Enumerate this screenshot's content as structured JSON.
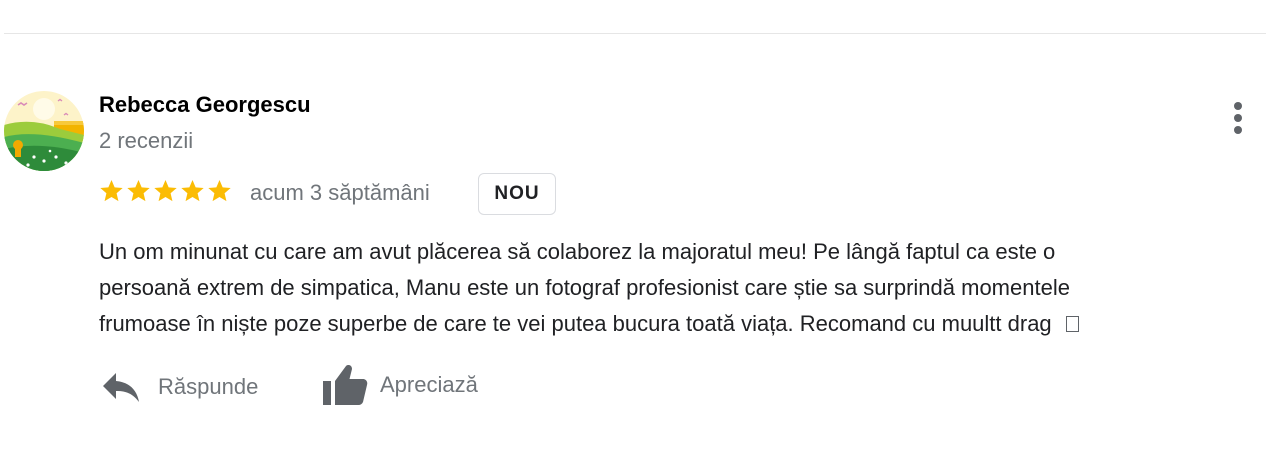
{
  "review": {
    "author": "Rebecca Georgescu",
    "review_count": "2 recenzii",
    "rating": 5,
    "rating_max": 5,
    "time": "acum 3 săptămâni",
    "badge": "NOU",
    "text_lines": [
      "Un om minunat cu care am avut plăcerea să colaborez la majoratul meu! Pe lângă faptul ca este o",
      "persoană extrem de simpatica, Manu este un fotograf profesionist care știe sa surprindă momentele",
      "frumoase în niște poze superbe de care te vei putea bucura toată viața. Recomand cu muultt drag"
    ]
  },
  "actions": {
    "reply_label": "Răspunde",
    "like_label": "Apreciază"
  },
  "colors": {
    "star": "#fbbc04",
    "muted_text": "#70757a",
    "icon": "#5f6368",
    "divider": "#e6e6e6"
  },
  "icons": {
    "more": "more-vert-icon",
    "reply": "reply-arrow-icon",
    "like": "thumbs-up-icon",
    "star": "star-icon"
  }
}
